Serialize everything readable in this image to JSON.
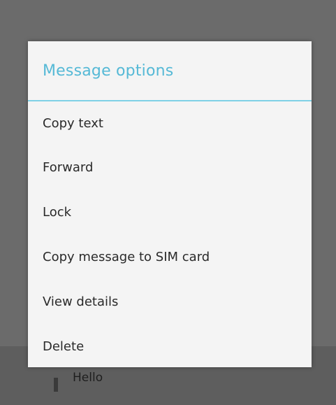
{
  "dialog": {
    "title": "Message options",
    "items": [
      {
        "label": "Copy text"
      },
      {
        "label": "Forward"
      },
      {
        "label": "Lock"
      },
      {
        "label": "Copy message to SIM card"
      },
      {
        "label": "View details"
      },
      {
        "label": "Delete"
      }
    ]
  },
  "background": {
    "partial_text": "Hello"
  },
  "colors": {
    "accent": "#55b9d6",
    "divider": "#7fd1e6",
    "scrim": "#6b6b6b",
    "dialog_bg": "#f4f4f4"
  }
}
